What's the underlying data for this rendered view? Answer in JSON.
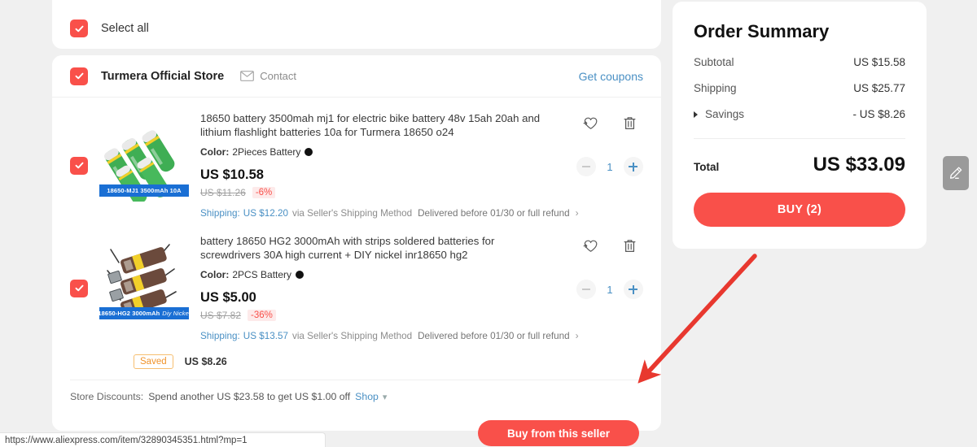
{
  "select_all": {
    "label": "Select all",
    "checked": true
  },
  "store": {
    "name": "Turmera Official Store",
    "checked": true,
    "contact_label": "Contact",
    "get_coupons_label": "Get coupons",
    "saved_badge": "Saved",
    "saved_amount": "US $8.26",
    "store_discounts_label": "Store Discounts:",
    "store_discounts_text": "Spend another US $23.58 to get US $1.00 off",
    "shop_link": "Shop",
    "buy_from_seller_label": "Buy from this seller"
  },
  "items": [
    {
      "checked": true,
      "title": "18650 battery 3500mah mj1 for electric bike battery 48v 15ah 20ah and lithium flashlight batteries 10a for Turmera 18650 o24",
      "color_label": "Color:",
      "color_value": "2Pieces Battery",
      "color_swatch": "#111111",
      "price": "US $10.58",
      "old_price": "US $11.26",
      "discount": "-6%",
      "shipping_label": "Shipping:",
      "shipping_price": "US $12.20",
      "shipping_via": "via Seller's Shipping Method",
      "shipping_delivery": "Delivered before 01/30 or full refund",
      "quantity": "1",
      "thumb_caption": "18650-MJ1 3500mAh 10A",
      "thumb_caption_italic": ""
    },
    {
      "checked": true,
      "title": "battery 18650 HG2 3000mAh with strips soldered batteries for screwdrivers 30A high current + DIY nickel inr18650 hg2",
      "color_label": "Color:",
      "color_value": "2PCS Battery",
      "color_swatch": "#111111",
      "price": "US $5.00",
      "old_price": "US $7.82",
      "discount": "-36%",
      "shipping_label": "Shipping:",
      "shipping_price": "US $13.57",
      "shipping_via": "via Seller's Shipping Method",
      "shipping_delivery": "Delivered before 01/30 or full refund",
      "quantity": "1",
      "thumb_caption": "18650-HG2 3000mAh",
      "thumb_caption_italic": "Diy Nickel"
    }
  ],
  "summary": {
    "title": "Order Summary",
    "subtotal_label": "Subtotal",
    "subtotal_value": "US $15.58",
    "shipping_label": "Shipping",
    "shipping_value": "US $25.77",
    "savings_label": "Savings",
    "savings_value": "- US $8.26",
    "total_label": "Total",
    "total_value": "US $33.09",
    "buy_button": "BUY (2)"
  },
  "status_bar": {
    "url": "https://www.aliexpress.com/item/32890345351.html?mp=1"
  },
  "colors": {
    "accent": "#f9504a",
    "link": "#4a90c4",
    "saved": "#f0932b"
  }
}
